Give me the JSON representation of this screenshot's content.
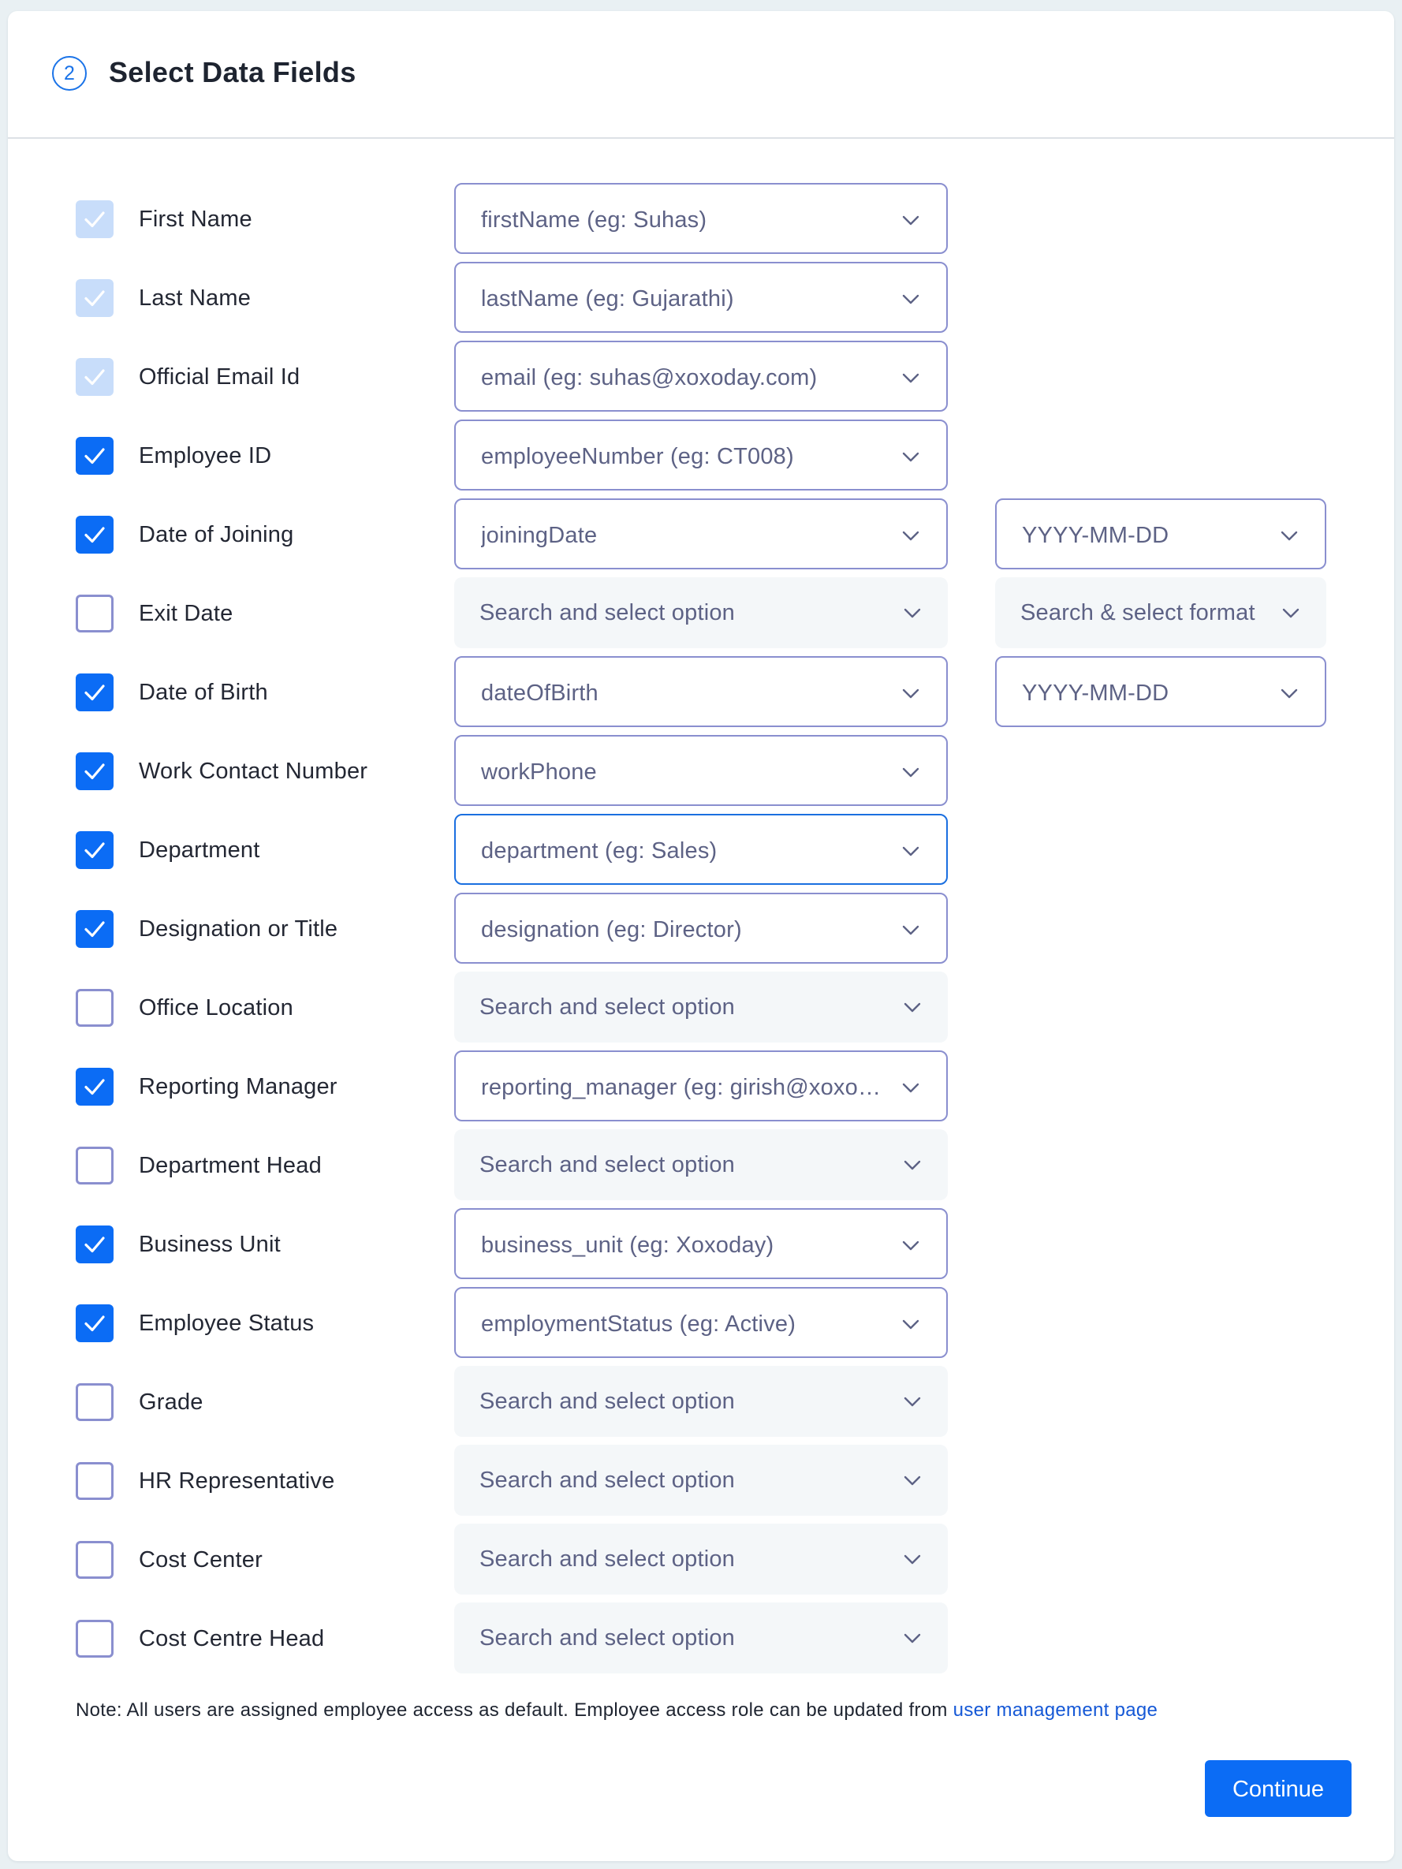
{
  "header": {
    "step_number": "2",
    "title": "Select Data Fields"
  },
  "fields": [
    {
      "label": "First Name",
      "state": "checked-disabled",
      "mapping": "firstName (eg: Suhas)",
      "mapping_style": "filled"
    },
    {
      "label": "Last Name",
      "state": "checked-disabled",
      "mapping": "lastName (eg: Gujarathi)",
      "mapping_style": "filled"
    },
    {
      "label": "Official Email Id",
      "state": "checked-disabled",
      "mapping": "email (eg: suhas@xoxoday.com)",
      "mapping_style": "filled"
    },
    {
      "label": "Employee ID",
      "state": "checked",
      "mapping": "employeeNumber (eg: CT008)",
      "mapping_style": "filled"
    },
    {
      "label": "Date of Joining",
      "state": "checked",
      "mapping": "joiningDate",
      "mapping_style": "filled",
      "format": "YYYY-MM-DD",
      "format_style": "filled"
    },
    {
      "label": "Exit Date",
      "state": "unchecked",
      "mapping": "Search and select option",
      "mapping_style": "empty",
      "format": "Search & select format",
      "format_style": "empty"
    },
    {
      "label": "Date of Birth",
      "state": "checked",
      "mapping": "dateOfBirth",
      "mapping_style": "filled",
      "format": "YYYY-MM-DD",
      "format_style": "filled"
    },
    {
      "label": "Work Contact Number",
      "state": "checked",
      "mapping": "workPhone",
      "mapping_style": "filled"
    },
    {
      "label": "Department",
      "state": "checked",
      "mapping": "department (eg: Sales)",
      "mapping_style": "focused"
    },
    {
      "label": "Designation or Title",
      "state": "checked",
      "mapping": "designation (eg: Director)",
      "mapping_style": "filled"
    },
    {
      "label": "Office Location",
      "state": "unchecked",
      "mapping": "Search and select option",
      "mapping_style": "empty"
    },
    {
      "label": "Reporting Manager",
      "state": "checked",
      "mapping": "reporting_manager (eg: girish@xoxoday.com)",
      "mapping_style": "filled"
    },
    {
      "label": "Department Head",
      "state": "unchecked",
      "mapping": "Search and select option",
      "mapping_style": "empty"
    },
    {
      "label": "Business Unit",
      "state": "checked",
      "mapping": "business_unit (eg: Xoxoday)",
      "mapping_style": "filled"
    },
    {
      "label": "Employee Status",
      "state": "checked",
      "mapping": "employmentStatus (eg: Active)",
      "mapping_style": "filled"
    },
    {
      "label": "Grade",
      "state": "unchecked",
      "mapping": "Search and select option",
      "mapping_style": "empty"
    },
    {
      "label": "HR Representative",
      "state": "unchecked",
      "mapping": "Search and select option",
      "mapping_style": "empty"
    },
    {
      "label": "Cost Center",
      "state": "unchecked",
      "mapping": "Search and select option",
      "mapping_style": "empty"
    },
    {
      "label": "Cost Centre Head",
      "state": "unchecked",
      "mapping": "Search and select option",
      "mapping_style": "empty"
    }
  ],
  "note": {
    "text": "Note: All users are assigned employee access as default. Employee access role can be updated from ",
    "link": "user management page"
  },
  "actions": {
    "continue_label": "Continue"
  },
  "colors": {
    "accent": "#0b6cf5",
    "checked_disabled": "#c8ddfa",
    "select_border": "#8a8fcf",
    "empty_select_bg": "#f4f7f9",
    "link": "#1558d6"
  }
}
